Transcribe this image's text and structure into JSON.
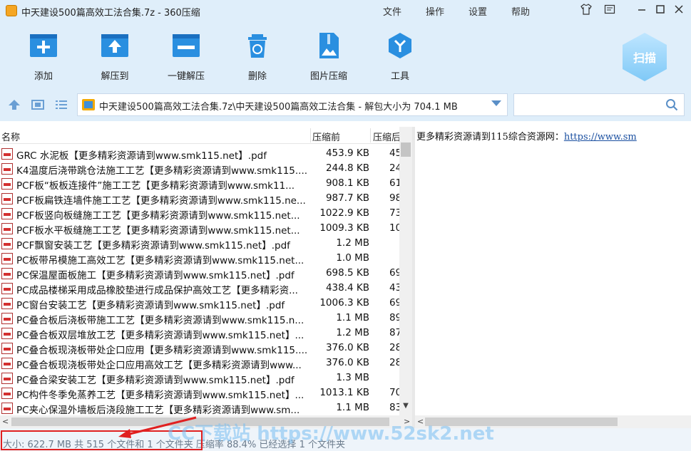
{
  "window": {
    "title": "中天建设500篇高效工法合集.7z - 360压缩",
    "menu": [
      "文件",
      "操作",
      "设置",
      "帮助"
    ]
  },
  "toolbar": {
    "items": [
      {
        "label": "添加",
        "icon": "add-icon"
      },
      {
        "label": "解压到",
        "icon": "extract-icon"
      },
      {
        "label": "一键解压",
        "icon": "one-click-extract-icon"
      },
      {
        "label": "删除",
        "icon": "delete-icon"
      },
      {
        "label": "图片压缩",
        "icon": "image-compress-icon"
      },
      {
        "label": "工具",
        "icon": "tools-icon"
      }
    ],
    "scan_label": "扫描"
  },
  "address": {
    "path": "中天建设500篇高效工法合集.7z\\中天建设500篇高效工法合集 - 解包大小为 704.1 MB",
    "search_placeholder": ""
  },
  "columns": {
    "name": "名称",
    "before": "压缩前",
    "after": "压缩后"
  },
  "files": [
    {
      "name": "GRC 水泥板【更多精彩资源请到www.smk115.net】.pdf",
      "size": "453.9 KB",
      "comp": "45"
    },
    {
      "name": "K4温度后浇带跳仓法施工工艺【更多精彩资源请到www.smk115....",
      "size": "244.8 KB",
      "comp": "24"
    },
    {
      "name": "PCF板“板板连接件”施工工艺【更多精彩资源请到www.smk11...",
      "size": "908.1 KB",
      "comp": "61"
    },
    {
      "name": "PCF板扁铁连墙件施工工艺【更多精彩资源请到www.smk115.ne...",
      "size": "987.7 KB",
      "comp": "98"
    },
    {
      "name": "PCF板竖向板缝施工工艺【更多精彩资源请到www.smk115.net...",
      "size": "1022.9 KB",
      "comp": "73"
    },
    {
      "name": "PCF板水平板缝施工工艺【更多精彩资源请到www.smk115.net...",
      "size": "1009.3 KB",
      "comp": "100"
    },
    {
      "name": "PCF飘窗安装工艺【更多精彩资源请到www.smk115.net】.pdf",
      "size": "1.2 MB",
      "comp": ""
    },
    {
      "name": "PC板带吊模施工高效工艺【更多精彩资源请到www.smk115.net...",
      "size": "1.0 MB",
      "comp": ""
    },
    {
      "name": "PC保温屋面板施工【更多精彩资源请到www.smk115.net】.pdf",
      "size": "698.5 KB",
      "comp": "69"
    },
    {
      "name": "PC成品楼梯采用成品橡胶垫进行成品保护高效工艺【更多精彩资...",
      "size": "438.4 KB",
      "comp": "43"
    },
    {
      "name": "PC窗台安装工艺【更多精彩资源请到www.smk115.net】.pdf",
      "size": "1006.3 KB",
      "comp": "69"
    },
    {
      "name": "PC叠合板后浇板带施工工艺【更多精彩资源请到www.smk115.n...",
      "size": "1.1 MB",
      "comp": "89"
    },
    {
      "name": "PC叠合板双层堆放工艺【更多精彩资源请到www.smk115.net】...",
      "size": "1.2 MB",
      "comp": "87"
    },
    {
      "name": "PC叠合板现浇板带处企口应用【更多精彩资源请到www.smk115....",
      "size": "376.0 KB",
      "comp": "28"
    },
    {
      "name": "PC叠合板现浇板带处企口应用高效工艺【更多精彩资源请到www...",
      "size": "376.0 KB",
      "comp": "28"
    },
    {
      "name": "PC叠合梁安装工艺【更多精彩资源请到www.smk115.net】.pdf",
      "size": "1.3 MB",
      "comp": ""
    },
    {
      "name": "PC构件冬季免蒸养工艺【更多精彩资源请到www.smk115.net】...",
      "size": "1013.1 KB",
      "comp": "70"
    },
    {
      "name": "PC夹心保温外墙板后浇段施工工艺【更多精彩资源请到www.sm...",
      "size": "1.1 MB",
      "comp": "83"
    }
  ],
  "preview": {
    "text": "更多精彩资源请到115综合资源网：",
    "link": "https://www.sm"
  },
  "status": {
    "text": "大小: 622.7 MB 共 515 个文件和 1 个文件夹 压缩率 88.4% 已经选择 1 个文件夹"
  },
  "watermark": "CC下载站 https://www.52sk2.net"
}
